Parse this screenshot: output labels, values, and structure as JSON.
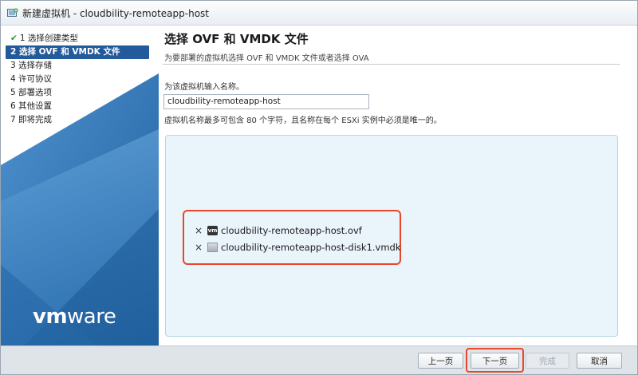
{
  "window": {
    "title": "新建虚拟机 - cloudbility-remoteapp-host",
    "icon": "new-vm-icon"
  },
  "sidebar": {
    "steps": [
      {
        "label": "1 选择创建类型",
        "state": "done"
      },
      {
        "label": "2 选择 OVF 和 VMDK 文件",
        "state": "active"
      },
      {
        "label": "3 选择存储",
        "state": "pending"
      },
      {
        "label": "4 许可协议",
        "state": "pending"
      },
      {
        "label": "5 部署选项",
        "state": "pending"
      },
      {
        "label": "6 其他设置",
        "state": "pending"
      },
      {
        "label": "7 即将完成",
        "state": "pending"
      }
    ],
    "check_glyph": "✔",
    "logo": {
      "prefix": "vm",
      "suffix": "ware"
    }
  },
  "main": {
    "title": "选择 OVF 和 VMDK 文件",
    "subtitle": "为要部署的虚拟机选择 OVF 和 VMDK 文件或者选择 OVA",
    "name_label": "为该虚拟机输入名称。",
    "name_value": "cloudbility-remoteapp-host",
    "name_help": "虚拟机名称最多可包含 80 个字符，且名称在每个 ESXi 实例中必须是唯一的。",
    "files": [
      {
        "name": "cloudbility-remoteapp-host.ovf",
        "icon": "vm-file-icon",
        "badge": "vm"
      },
      {
        "name": "cloudbility-remoteapp-host-disk1.vmdk",
        "icon": "disk-file-icon",
        "badge": ""
      }
    ],
    "remove_glyph": "×"
  },
  "footer": {
    "back_label": "上一页",
    "next_label": "下一页",
    "finish_label": "完成",
    "cancel_label": "取消"
  },
  "colors": {
    "active_step": "#235a9b",
    "highlight": "#e8472a",
    "dropzone": "#eaf4fb"
  }
}
